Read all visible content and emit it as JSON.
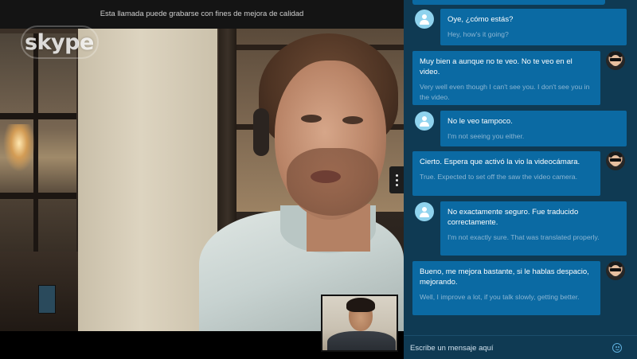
{
  "call": {
    "recording_notice": "Esta llamada puede grabarse con fines de mejora de calidad",
    "watermark": "skype"
  },
  "chat": {
    "messages": [
      {
        "sender": "remote",
        "original": "Oye, ¿cómo estás?",
        "translation": "Hey, how's it going?"
      },
      {
        "sender": "me",
        "original": "Muy bien a aunque no te veo. No te veo en el video.",
        "translation": "Very well even though I can't see you. I don't see you in the video."
      },
      {
        "sender": "remote",
        "original": "No le veo tampoco.",
        "translation": "I'm not seeing you either."
      },
      {
        "sender": "me",
        "original": "Cierto. Espera que activó la vio la videocámara.",
        "translation": "True. Expected to set off the saw the video camera."
      },
      {
        "sender": "remote",
        "original": "No exactamente seguro. Fue traducido correctamente.",
        "translation": "I'm not exactly sure. That was translated properly."
      },
      {
        "sender": "me",
        "original": "Bueno, me mejora bastante, si le hablas despacio, mejorando.",
        "translation": "Well, I improve a lot, if you talk slowly, getting better."
      }
    ],
    "compose": {
      "placeholder": "Escribe un mensaje aquí"
    }
  },
  "icons": {
    "remote_avatar": "person-placeholder-icon",
    "my_avatar": "user-photo-avatar",
    "emoji": "smiley-icon",
    "overflow": "vertical-ellipsis-icon"
  },
  "colors": {
    "chat_background": "#0f3a53",
    "bubble": "#0b6aa3",
    "translation_text": "#8cb6d3",
    "emoji_accent": "#5fb0de"
  }
}
